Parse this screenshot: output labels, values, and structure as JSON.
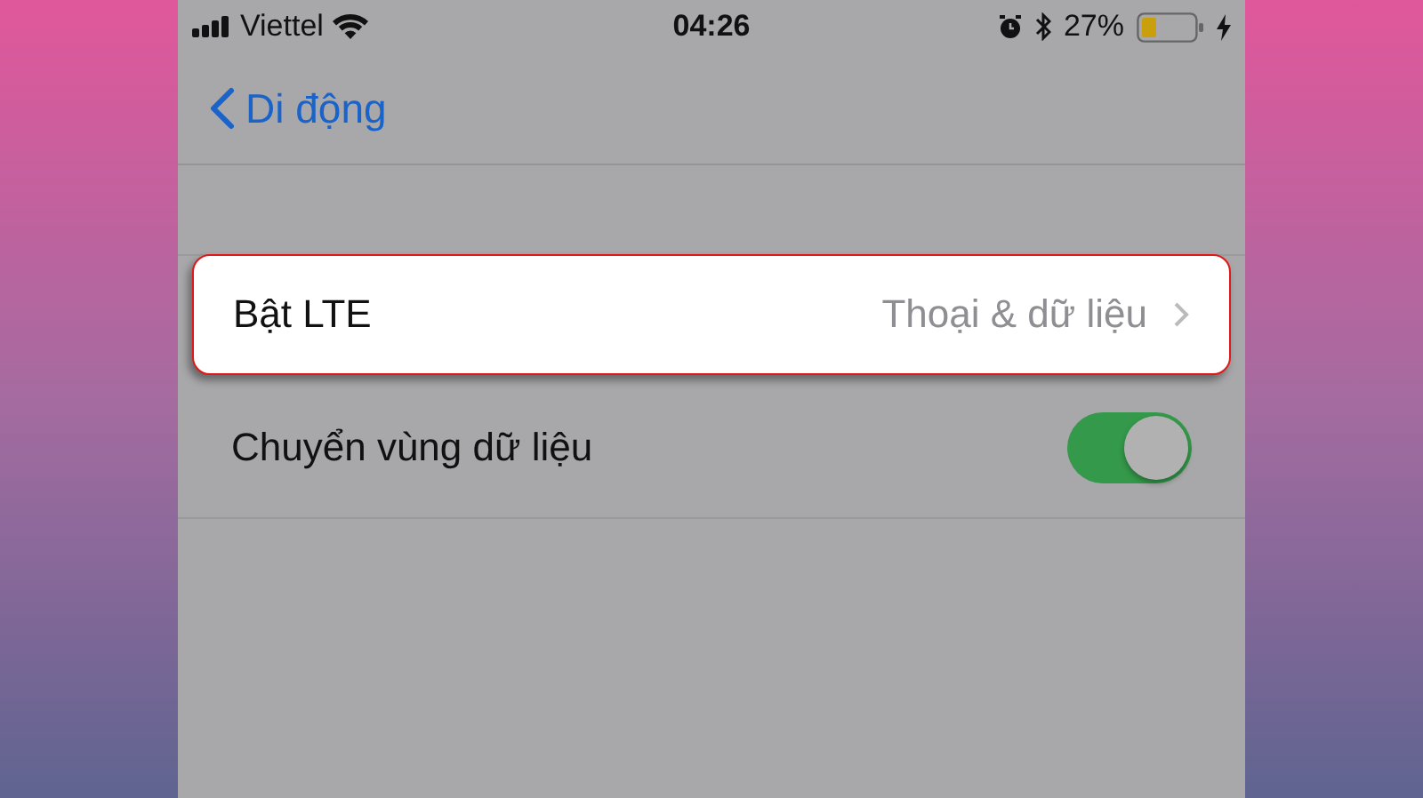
{
  "status_bar": {
    "carrier": "Viettel",
    "time": "04:26",
    "battery": "27%",
    "charging": true
  },
  "nav": {
    "back_label": "Di động"
  },
  "rows": [
    {
      "kind": "link",
      "label": "Bật LTE",
      "value": "Thoại & dữ liệu",
      "highlighted": true
    },
    {
      "kind": "toggle",
      "label": "Chuyển vùng dữ liệu",
      "on": true,
      "highlighted": false
    }
  ]
}
